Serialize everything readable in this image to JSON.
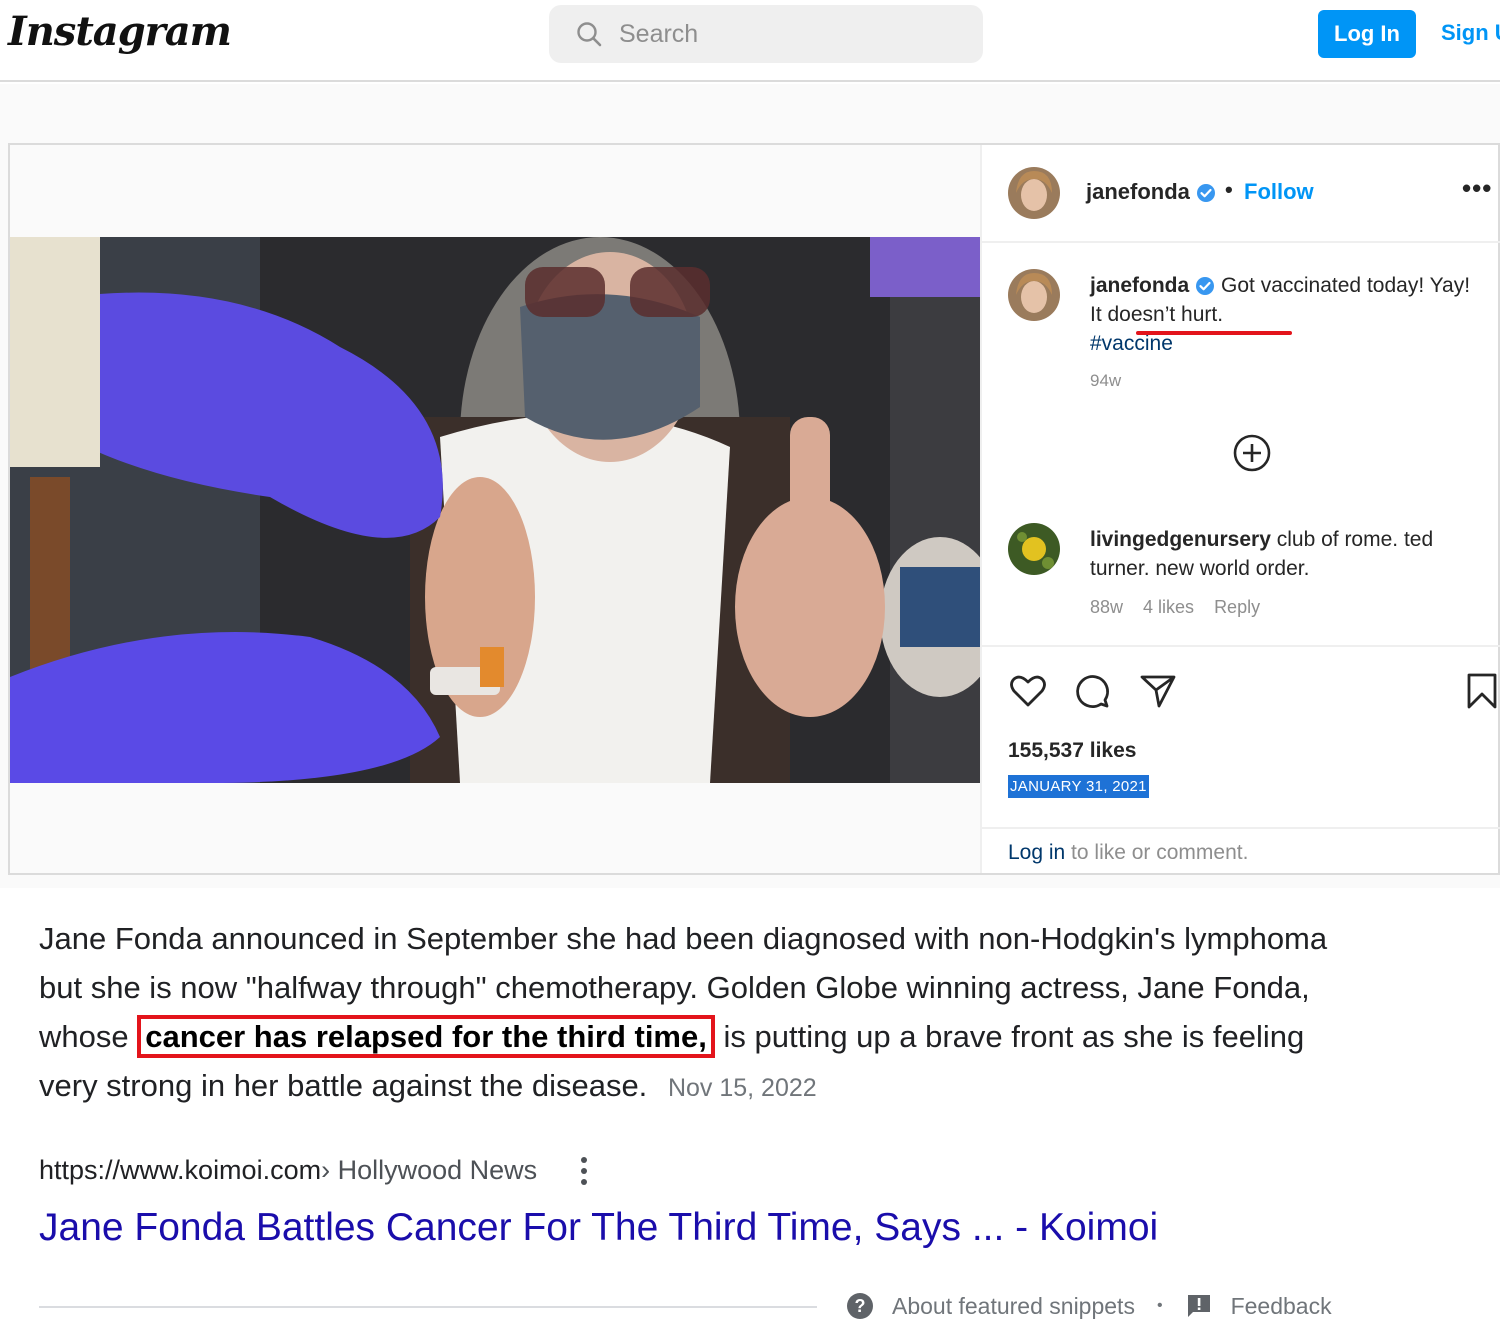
{
  "topbar": {
    "logo": "Instagram",
    "search_placeholder": "Search",
    "login_label": "Log In",
    "signup_label": "Sign U"
  },
  "post": {
    "header": {
      "username": "janefonda",
      "separator": "•",
      "follow_label": "Follow",
      "more_label": "•••"
    },
    "caption": {
      "username": "janefonda",
      "text_before_underline": "Got vaccinated today! Yay! ",
      "underlined_text": "It doesn’t hurt.",
      "hashtag": "#vaccine",
      "time": "94w"
    },
    "comment": {
      "username": "livingedgenursery",
      "text": "club of rome. ted turner. new world order.",
      "time": "88w",
      "likes": "4 likes",
      "reply_label": "Reply"
    },
    "likes": "155,537 likes",
    "date": "JANUARY 31, 2021",
    "login_prompt": {
      "link": "Log in",
      "rest": " to like or comment."
    },
    "icons": [
      "heart-icon",
      "comment-icon",
      "share-icon",
      "bookmark-icon",
      "add-circle-icon",
      "verified-icon"
    ]
  },
  "snippet": {
    "text_before": "Jane Fonda announced in September she had been diagnosed with non-Hodgkin's lymphoma but she is now \"halfway through\" chemotherapy. Golden Globe winning actress, Jane Fonda, whose",
    "highlight": "cancer has relapsed for the third time,",
    "text_after": "is putting up a brave front as she is feeling very strong in her battle against the disease.",
    "date": "Nov 15, 2022"
  },
  "result": {
    "url": "https://www.koimoi.com",
    "breadcrumb": " › Hollywood News",
    "title": "Jane Fonda Battles Cancer For The Third Time, Says ... - Koimoi"
  },
  "footer": {
    "about_label": "About featured snippets",
    "separator": "•",
    "feedback_label": "Feedback"
  },
  "colors": {
    "instagram_blue": "#0095f6",
    "google_link": "#1a0dab",
    "highlight_red": "#e3141b",
    "date_selection": "#1e72d6"
  }
}
